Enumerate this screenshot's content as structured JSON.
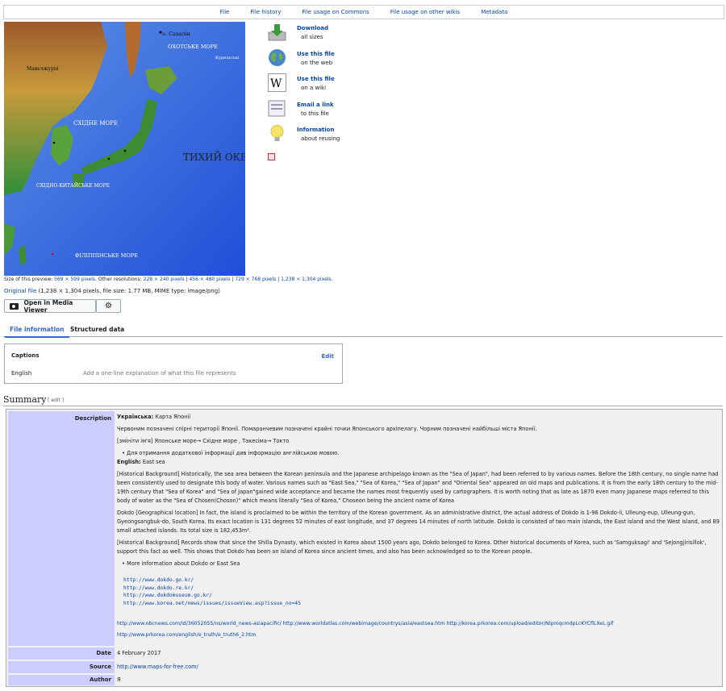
{
  "top_tabs": [
    "File",
    "File history",
    "File usage on Commons",
    "File usage on other wikis",
    "Metadata"
  ],
  "map": {
    "labels": {
      "sakhalin": "о. Сахалін",
      "okhotsk": "ОХОТСЬКЕ МОРЕ",
      "kuriles": "Курильські",
      "manchuria": "Маньчжурія",
      "east_sea": "СХІДНЕ МОРЕ",
      "pacific": "ТИХИЙ ОКЕАН",
      "east_china": "СХІДНО-КИТАЙСЬКЕ МОРЕ",
      "philippine": "ФІЛІППІНСЬКЕ МОРЕ"
    }
  },
  "actions": [
    {
      "icon": "download-icon",
      "title": "Download",
      "sub": "all sizes"
    },
    {
      "icon": "globe-icon",
      "title": "Use this file",
      "sub": "on the web"
    },
    {
      "icon": "wiki-icon",
      "title": "Use this file",
      "sub": "on a wiki"
    },
    {
      "icon": "email-icon",
      "title": "Email a link",
      "sub": "to this file"
    },
    {
      "icon": "lightbulb-icon",
      "title": "Information",
      "sub": "about reusing"
    }
  ],
  "preview": {
    "prefix": "Size of this preview:",
    "size": "569 × 599 pixels",
    "other": ". Other resolutions:",
    "resolutions": [
      "228 × 240 pixels",
      "456 × 480 pixels",
      "729 × 768 pixels",
      "1,238 × 1,304 pixels"
    ]
  },
  "original": {
    "link": "Original file",
    "info": "(1,238 × 1,304 pixels, file size: 1.77 MB, MIME type: image/png)"
  },
  "media_viewer_btn": "Open in Media Viewer",
  "file_tabs": [
    "File information",
    "Structured data"
  ],
  "captions": {
    "heading": "Captions",
    "edit": "Edit",
    "lang": "English",
    "placeholder": "Add a one-line explanation of what this file represents"
  },
  "summary": {
    "heading": "Summary",
    "edit": "[ edit ]"
  },
  "infobox": {
    "description_label": "Description",
    "uk_label": "Українська:",
    "uk_title": "Карта Японії",
    "uk_text1": "Червоним позначені спірні території Японії. Помаранчевим позначені крайні точки Японського архіпелагу. Чорним позначені найбільші міста Японії.",
    "uk_text2": "[змініти ім'я] Японське море→ Східне море , Такесіма→ Токто",
    "uk_text3": "Для отримання додаткової інформації див інформацію англійською мовою.",
    "en_label": "English:",
    "en_title": "East sea",
    "hist1": "[Historical Background] Historically, the sea area between the Korean peninsula and the Japanese archipelago known as the \"Sea of Japan\", had been referred to by various names. Before the 18th century, no single name had been consistently used to designate this body of water. Various names such as \"East Sea,\" \"Sea of Korea,\" \"Sea of Japan\" and \"Oriental Sea\" appeared on old maps and publications. It is from the early 18th century to the mid-19th century that \"Sea of Korea\" and \"Sea of Japan\"gained wide acceptance and became the names most frequently used by cartographers. It is worth noting that as late as 1870 even many Japanese maps referred to this body of water as the \"Sea of Chosen(Choson)\" which means literally \"Sea of Korea,\" Choseon being the ancient name of Korea",
    "geo": "Dokdo [Geographical location] In fact, the island is proclaimed to be within the territory of the Korean government. As an administrative district, the actual address of Dokdo is 1-96 Dokdo-li, Ulleung-eup, Ulleung-gun, Gyeongsangbuk-do, South Korea. Its exact location is 131 degrees 52 minutes of east longitude, and 37 degrees 14 minutes of north latitude. Dokdo is consisted of two main islands, the East island and the West island, and 89 small attached islands. Its total size is 182,453m².",
    "hist2": "[Historical Background] Records show that since the Shilla Dynasty, which existed in Korea about 1500 years ago, Dokdo belonged to Korea. Other historical documents of Korea, such as 'Samguksagi' and 'Sejongjirisillok', support this fact as well. This shows that Dokdo has been an island of Korea since ancient times, and also has been acknowledged so to the Korean people.",
    "more": "More information about Dokdo or East Sea",
    "urls": [
      "http://www.dokdo.go.kr/",
      "http://www.dokdo.re.kr/",
      "http://www.dokdomuseum.go.kr/",
      "http://www.korea.net/news/issues/issueView.asp?issue_no=45"
    ],
    "links_row1": [
      "http://www.nbcnews.com/id/36052055/ns/world_news-asiapacific/",
      "http://www.worldatlas.com/webimage/countrys/asia/eastsea.htm",
      "http://korea.prkorea.com/upload/editor/NlpmqcmdpLcKYCflLXeL.gif"
    ],
    "links_row2": "http://www.prkorea.com/english/e_truth/e_truth6_2.htm",
    "date_label": "Date",
    "date": "4 February 2017",
    "source_label": "Source",
    "source": "http://www.maps-for-free.com/",
    "author_label": "Author",
    "author": "Я"
  }
}
